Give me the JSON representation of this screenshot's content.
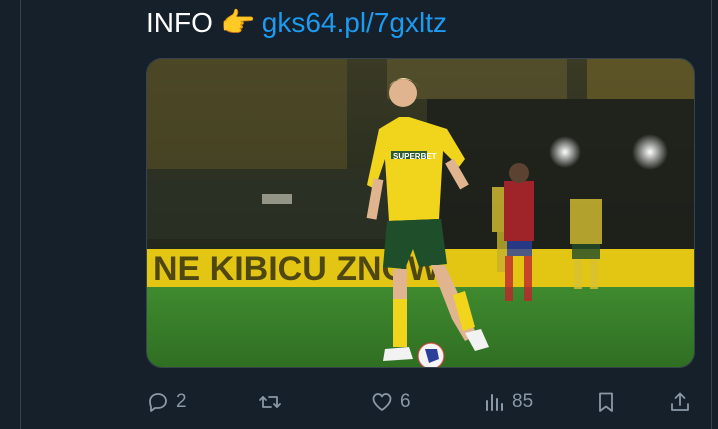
{
  "tweet": {
    "text_prefix": "INFO",
    "emoji": "👉",
    "link": "gks64.pl/7gxltz"
  },
  "media": {
    "description_icon": "football-photo",
    "banner_text": "NE KIBICU ZNOW",
    "shirt_sponsor": "SUPERBET"
  },
  "actions": {
    "reply_count": "2",
    "retweet_count": "",
    "like_count": "6",
    "views_count": "85"
  },
  "colors": {
    "background": "#15202b",
    "link": "#1d9bf0",
    "icon": "#8b98a5"
  }
}
